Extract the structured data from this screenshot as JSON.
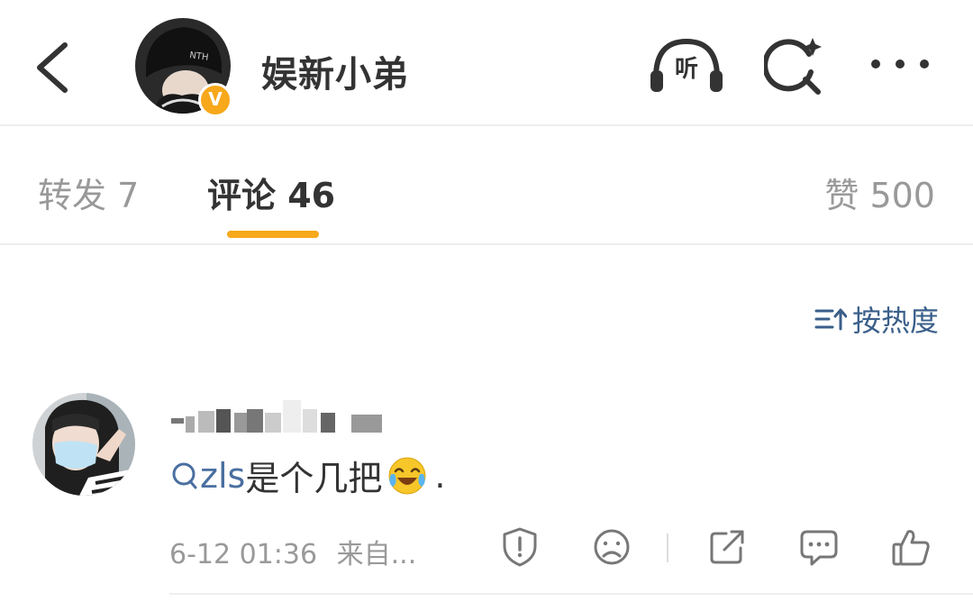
{
  "header": {
    "username": "娱新小弟",
    "verified_badge": "V",
    "listen_label": "听",
    "icons": [
      "back-arrow-icon",
      "headphones-icon",
      "search-sparkle-icon",
      "more-dots-icon"
    ]
  },
  "tabs": {
    "repost": "转发 7",
    "comment": "评论 46",
    "like": "赞 500",
    "active": "comment",
    "accent_color": "#f7a81b"
  },
  "sort": {
    "label": "按热度",
    "icon": "sort-icon",
    "color": "#3a5f8a"
  },
  "comment": {
    "username_blurred": true,
    "mention": "zls",
    "text": " 是个几把",
    "emoji": "laughing-crying-emoji",
    "trailing": " .",
    "time": "6-12 01:36",
    "source": "来自...",
    "actions": [
      "report-icon",
      "dislike-face-icon",
      "share-icon",
      "reply-icon",
      "like-thumb-icon"
    ],
    "mention_color": "#4a6fa0"
  }
}
